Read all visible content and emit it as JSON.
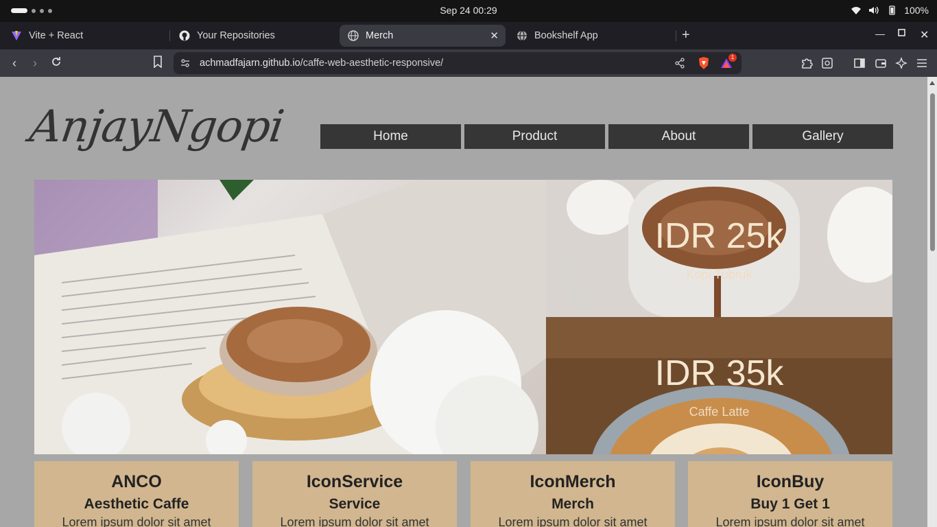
{
  "os": {
    "clock": "Sep 24  00:29",
    "battery": "100%"
  },
  "tabs": [
    {
      "label": "Vite + React",
      "icon": "vite-icon"
    },
    {
      "label": "Your Repositories",
      "icon": "github-icon"
    },
    {
      "label": "Merch",
      "icon": "globe-icon",
      "active": true
    },
    {
      "label": "Bookshelf App",
      "icon": "globe-icon"
    }
  ],
  "address": {
    "host": "achmadfajarn.github.io",
    "path": "/caffe-web-aesthetic-responsive/",
    "brave_badge": "1"
  },
  "page": {
    "logo": "AnjayNgopi",
    "menu": [
      "Home",
      "Product",
      "About",
      "Gallery"
    ],
    "offers": [
      {
        "price": "IDR 25k",
        "name": "Kopi Tubruk"
      },
      {
        "price": "IDR 35k",
        "name": "Caffe Latte"
      }
    ],
    "cards": [
      {
        "title": "ANCO",
        "subtitle": "Aesthetic Caffe",
        "text": "Lorem ipsum dolor sit amet"
      },
      {
        "title": "IconService",
        "subtitle": "Service",
        "text": "Lorem ipsum dolor sit amet"
      },
      {
        "title": "IconMerch",
        "subtitle": "Merch",
        "text": "Lorem ipsum dolor sit amet"
      },
      {
        "title": "IconBuy",
        "subtitle": "Buy 1 Get 1",
        "text": "Lorem ipsum dolor sit amet"
      }
    ]
  },
  "colors": {
    "page_bg": "#a7a7a7",
    "menu_bg": "#363636",
    "card_bg": "#d1b68f",
    "price_text": "#f5e6cf"
  }
}
